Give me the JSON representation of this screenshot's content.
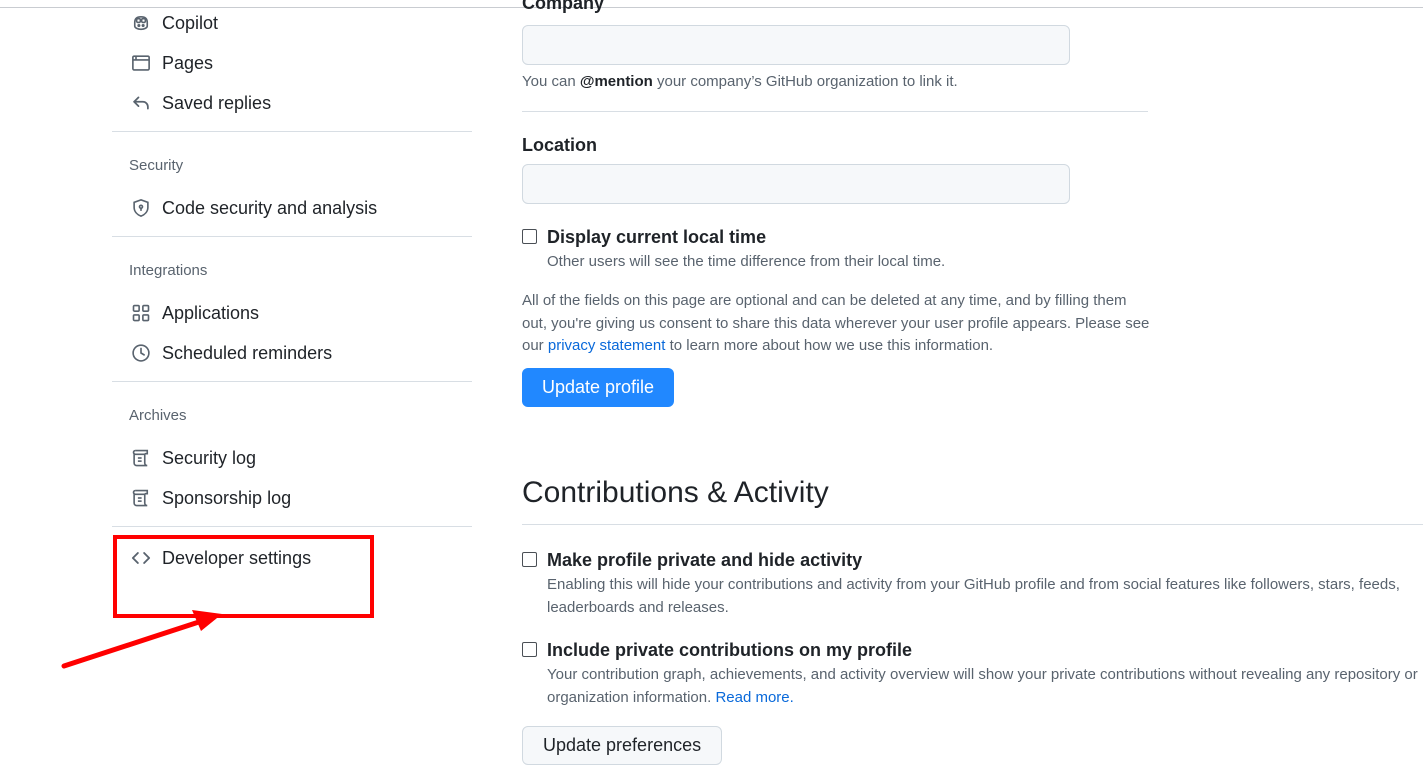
{
  "sidebar": {
    "top_items": [
      {
        "label": "Copilot",
        "icon": "copilot-icon"
      },
      {
        "label": "Pages",
        "icon": "browser-icon"
      },
      {
        "label": "Saved replies",
        "icon": "reply-icon"
      }
    ],
    "security": {
      "heading": "Security",
      "items": [
        {
          "label": "Code security and analysis",
          "icon": "shield-lock-icon"
        }
      ]
    },
    "integrations": {
      "heading": "Integrations",
      "items": [
        {
          "label": "Applications",
          "icon": "apps-icon"
        },
        {
          "label": "Scheduled reminders",
          "icon": "clock-icon"
        }
      ]
    },
    "archives": {
      "heading": "Archives",
      "items": [
        {
          "label": "Security log",
          "icon": "log-icon"
        },
        {
          "label": "Sponsorship log",
          "icon": "log-icon"
        }
      ]
    },
    "developer_settings": {
      "label": "Developer settings",
      "icon": "code-icon"
    }
  },
  "profile": {
    "company": {
      "label": "Company",
      "value": "",
      "note_prefix": "You can ",
      "note_mention": "@mention",
      "note_suffix": " your company’s GitHub organization to link it."
    },
    "location": {
      "label": "Location",
      "value": ""
    },
    "local_time": {
      "checked": false,
      "label": "Display current local time",
      "description": "Other users will see the time difference from their local time."
    },
    "consent": {
      "line1": "All of the fields on this page are optional and can be deleted at any time, and by filling them",
      "line2": "out, you're giving us consent to share this data wherever your user profile appears. Please see",
      "line3_prefix": "our ",
      "link": "privacy statement",
      "line3_suffix": " to learn more about how we use this information."
    },
    "update_button": "Update profile"
  },
  "contributions": {
    "title": "Contributions & Activity",
    "private_profile": {
      "checked": false,
      "label": "Make profile private and hide activity",
      "desc_line1": "Enabling this will hide your contributions and activity from your GitHub profile and from social features like followers, stars, feeds,",
      "desc_line2": "leaderboards and releases."
    },
    "private_contributions": {
      "checked": false,
      "label": "Include private contributions on my profile",
      "desc_line1": "Your contribution graph, achievements, and activity overview will show your private contributions without revealing any repository or",
      "desc_line2_prefix": "organization information. ",
      "desc_link": "Read more."
    },
    "update_button": "Update preferences"
  },
  "annotation": {
    "color": "#ff0000"
  }
}
